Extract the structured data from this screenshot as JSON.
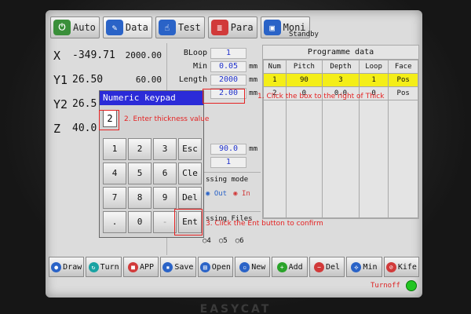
{
  "tabs": [
    {
      "label": "Auto",
      "icon": "auto-icon",
      "color": "#3a8f3a"
    },
    {
      "label": "Data",
      "icon": "pencil-icon",
      "color": "#2a63c7"
    },
    {
      "label": "Test",
      "icon": "hand-icon",
      "color": "#2a63c7"
    },
    {
      "label": "Para",
      "icon": "settings-icon",
      "color": "#d13a3a"
    },
    {
      "label": "Moni",
      "icon": "monitor-icon",
      "color": "#2a63c7"
    }
  ],
  "status": "Standby",
  "axes": [
    {
      "name": "X",
      "value": "-349.71",
      "set": "2000.00"
    },
    {
      "name": "Y1",
      "value": "26.50",
      "set": "60.00"
    },
    {
      "name": "Y2",
      "value": "26.5",
      "set": ""
    },
    {
      "name": "Z",
      "value": "40.0",
      "set": ""
    }
  ],
  "params": [
    {
      "label": "BLoop",
      "value": "1",
      "unit": ""
    },
    {
      "label": "Min",
      "value": "0.05",
      "unit": "mm"
    },
    {
      "label": "Length",
      "value": "2000",
      "unit": "mm"
    },
    {
      "label": "",
      "value": "2.00",
      "unit": "mm"
    }
  ],
  "params_lower": [
    {
      "value": "90.0",
      "unit": "mm"
    },
    {
      "value": "1",
      "unit": ""
    }
  ],
  "processing_mode": {
    "label": "ssing mode",
    "opt1": "Out",
    "opt2": "In"
  },
  "processing_files": {
    "label": "ssing Files",
    "opts": [
      "4",
      "5",
      "6"
    ]
  },
  "programme": {
    "title": "Programme data",
    "headers": [
      "Num",
      "Pitch",
      "Depth",
      "Loop",
      "Face"
    ],
    "rows": [
      [
        "1",
        "90",
        "3",
        "1",
        "Pos"
      ],
      [
        "2",
        "0",
        "0.0",
        "0",
        "Pos"
      ]
    ]
  },
  "keypad": {
    "title": "Numeric keypad",
    "entry": "2",
    "keys": [
      "1",
      "2",
      "3",
      "Esc",
      "4",
      "5",
      "6",
      "Cle",
      "7",
      "8",
      "9",
      "Del",
      ".",
      "0",
      "-",
      "Ent"
    ]
  },
  "toolbar": [
    {
      "label": "Draw",
      "color": "#2a63c7",
      "icon": "draw-icon"
    },
    {
      "label": "Turn",
      "color": "#1aa3a3",
      "icon": "turn-icon"
    },
    {
      "label": "APP",
      "color": "#d13a3a",
      "icon": "app-icon"
    },
    {
      "label": "Save",
      "color": "#2a63c7",
      "icon": "save-icon"
    },
    {
      "label": "Open",
      "color": "#2a63c7",
      "icon": "open-icon"
    },
    {
      "label": "New",
      "color": "#2a63c7",
      "icon": "new-icon"
    },
    {
      "label": "Add",
      "color": "#2aa32a",
      "icon": "add-icon"
    },
    {
      "label": "Del",
      "color": "#d13a3a",
      "icon": "delete-icon"
    },
    {
      "label": "Min",
      "color": "#2a63c7",
      "icon": "min-icon"
    },
    {
      "label": "Kife",
      "color": "#d13a3a",
      "icon": "knife-icon"
    }
  ],
  "turnoff": "Turnoff",
  "brand": "EASYCAT",
  "annotations": {
    "a1": "1. Click the box to the right of Thick",
    "a2": "2. Enter thickness value",
    "a3": "3. Click the Ent button to confirm"
  }
}
